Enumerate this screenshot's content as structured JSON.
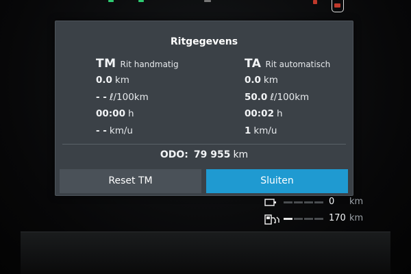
{
  "dialog": {
    "title": "Ritgegevens",
    "trip_manual": {
      "abbr": "TM",
      "name": "Rit handmatig",
      "distance": {
        "value": "0.0",
        "unit": "km"
      },
      "consumption": {
        "value": "- -",
        "unit": "ℓ/100km"
      },
      "time": {
        "value": "00:00",
        "unit": "h"
      },
      "speed": {
        "value": "- -",
        "unit": "km/u"
      }
    },
    "trip_auto": {
      "abbr": "TA",
      "name": "Rit automatisch",
      "distance": {
        "value": "0.0",
        "unit": "km"
      },
      "consumption": {
        "value": "50.0",
        "unit": "ℓ/100km"
      },
      "time": {
        "value": "00:02",
        "unit": "h"
      },
      "speed": {
        "value": "1",
        "unit": "km/u"
      }
    },
    "odometer": {
      "label": "ODO:",
      "value": "79 955",
      "unit": "km"
    },
    "buttons": {
      "reset_label": "Reset TM",
      "close_label": "Sluiten"
    }
  },
  "range": {
    "electric": {
      "icon": "battery-plug-icon",
      "value": "0",
      "unit": "km",
      "level": 0
    },
    "fuel": {
      "icon": "fuel-pump-icon",
      "value": "170",
      "unit": "km",
      "level": 0.33
    }
  },
  "colors": {
    "dialog_bg": "#3b4147",
    "button_primary": "#1f9ad1",
    "button_secondary": "#4a5158",
    "text": "#f2f4f6"
  }
}
